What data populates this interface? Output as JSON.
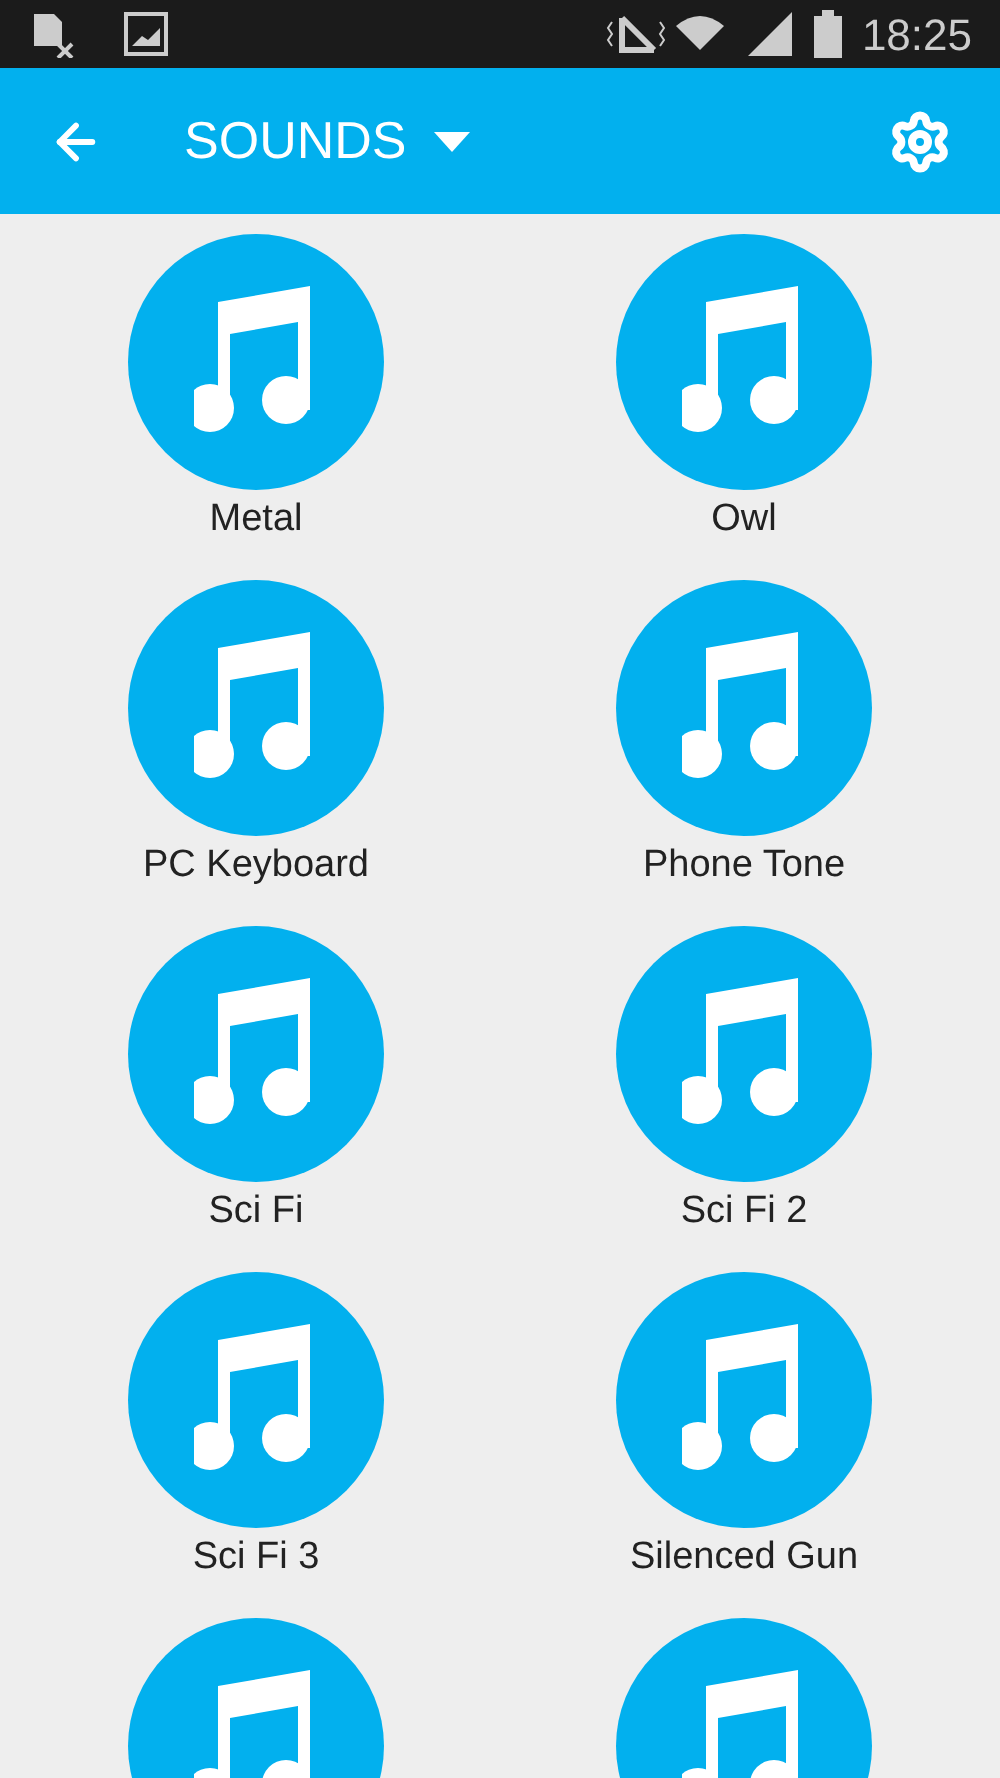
{
  "status_bar": {
    "time": "18:25"
  },
  "app_bar": {
    "title": "SOUNDS"
  },
  "sounds": [
    {
      "kind": "sound",
      "label": "Metal"
    },
    {
      "kind": "sound",
      "label": "Owl"
    },
    {
      "kind": "sound",
      "label": "PC Keyboard"
    },
    {
      "kind": "sound",
      "label": "Phone Tone"
    },
    {
      "kind": "sound",
      "label": "Sci Fi"
    },
    {
      "kind": "sound",
      "label": "Sci Fi 2"
    },
    {
      "kind": "sound",
      "label": "Sci Fi 3"
    },
    {
      "kind": "sound",
      "label": "Silenced Gun"
    },
    {
      "kind": "sound"
    },
    {
      "kind": "sound"
    }
  ]
}
